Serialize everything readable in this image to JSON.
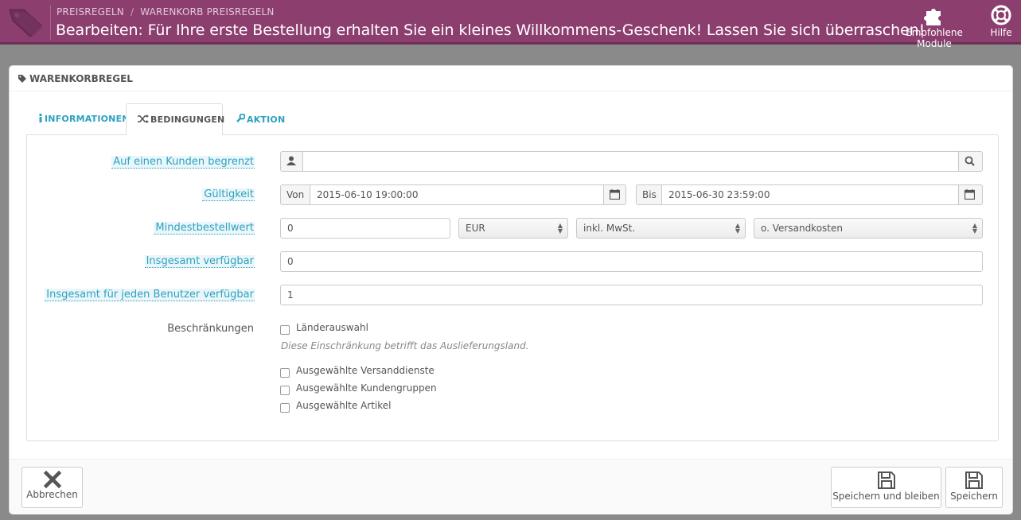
{
  "header": {
    "breadcrumb": [
      "PREISREGELN",
      "WARENKORB PREISREGELN"
    ],
    "title": "Bearbeiten: Für Ihre erste Bestellung erhalten Sie ein kleines Willkommens-Geschenk! Lassen Sie sich überraschen!",
    "modules_label": "Empfohlene Module",
    "help_label": "Hilfe"
  },
  "panel": {
    "heading": "WARENKORBREGEL",
    "tabs": [
      {
        "label": "INFORMATIONEN"
      },
      {
        "label": "BEDINGUNGEN"
      },
      {
        "label": "AKTION"
      }
    ]
  },
  "form": {
    "customer_label": "Auf einen Kunden begrenzt",
    "customer_value": "",
    "validity_label": "Gültigkeit",
    "from_label": "Von",
    "from_value": "2015-06-10 19:00:00",
    "to_label": "Bis",
    "to_value": "2015-06-30 23:59:00",
    "min_amount_label": "Mindestbestellwert",
    "min_amount_value": "0",
    "currency": "EUR",
    "tax": "inkl. MwSt.",
    "shipping": "o. Versandkosten",
    "total_available_label": "Insgesamt verfügbar",
    "total_available_value": "0",
    "per_user_label": "Insgesamt für jeden Benutzer verfügbar",
    "per_user_value": "1",
    "restrictions_label": "Beschränkungen",
    "restriction_country": "Länderauswahl",
    "restriction_country_hint": "Diese Einschränkung betrifft das Auslieferungsland.",
    "restriction_carriers": "Ausgewählte Versanddienste",
    "restriction_groups": "Ausgewählte Kundengruppen",
    "restriction_products": "Ausgewählte Artikel"
  },
  "footer": {
    "cancel_label": "Abbrechen",
    "save_stay_label": "Speichern und bleiben",
    "save_label": "Speichern"
  },
  "colors": {
    "header_bg": "#8c3e6f",
    "link": "#2ba2c2"
  }
}
